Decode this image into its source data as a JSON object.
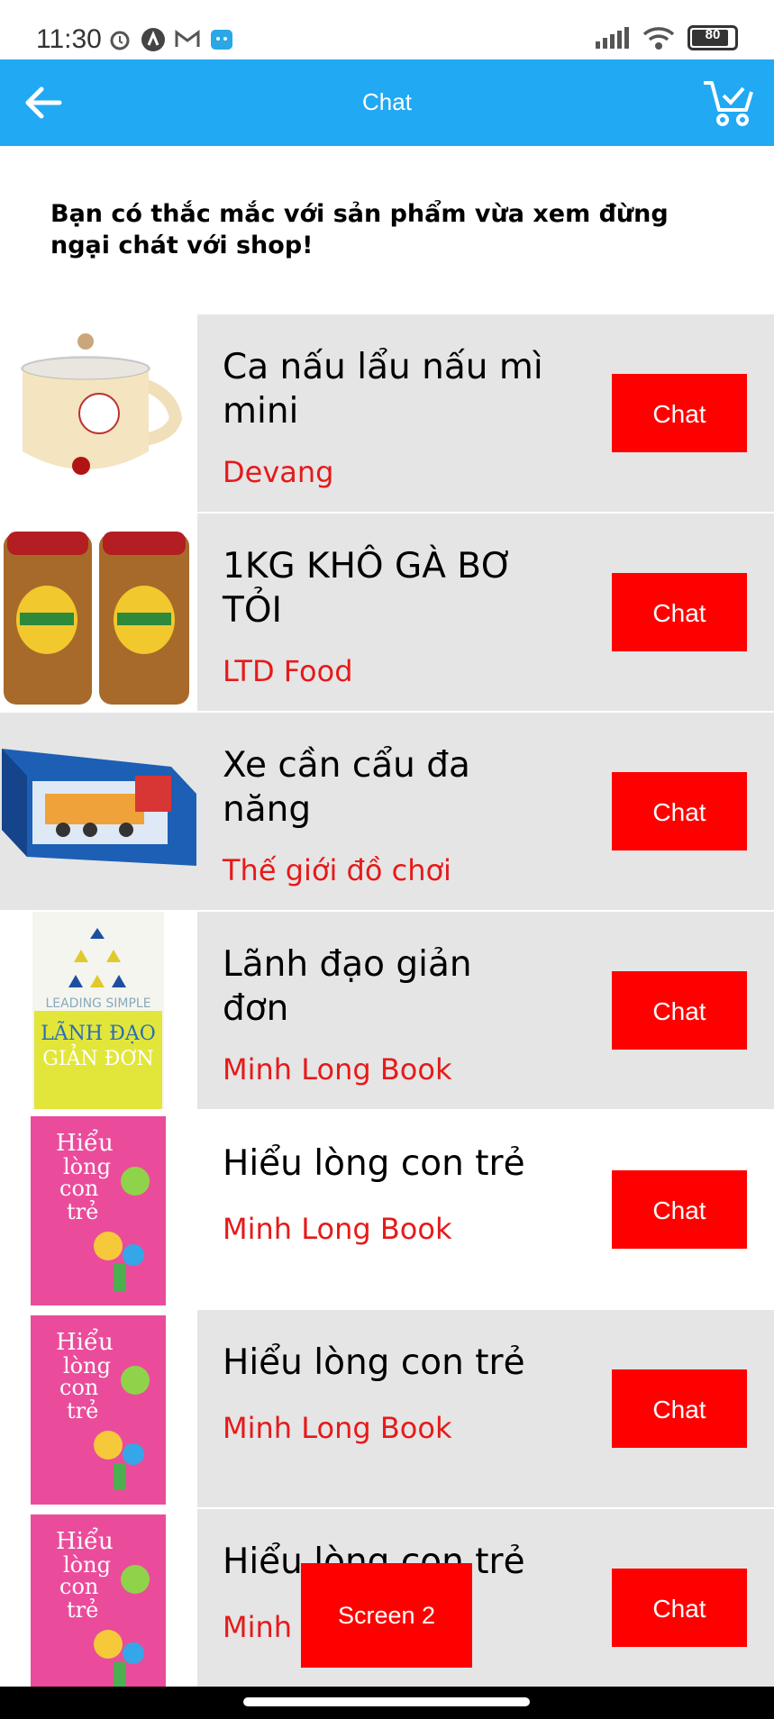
{
  "status": {
    "time": "11:30",
    "battery": "80"
  },
  "appbar": {
    "title": "Chat"
  },
  "intro": "Bạn có thắc mắc với sản phẩm vừa xem đừng ngại chát với shop!",
  "items": [
    {
      "name": "Ca nấu lẩu nấu mì mini",
      "shop": "Devang",
      "chat": "Chat"
    },
    {
      "name": "1KG KHÔ GÀ BƠ TỎI",
      "shop": "LTD Food",
      "chat": "Chat"
    },
    {
      "name": "Xe cần cẩu đa năng",
      "shop": "Thế giới đồ chơi",
      "chat": "Chat"
    },
    {
      "name": "Lãnh đạo giản đơn",
      "shop": "Minh Long Book",
      "chat": "Chat"
    },
    {
      "name": "Hiểu lòng con trẻ",
      "shop": "Minh Long Book",
      "chat": "Chat"
    },
    {
      "name": "Hiểu lòng con trẻ",
      "shop": "Minh Long Book",
      "chat": "Chat"
    },
    {
      "name": "Hiểu lòng con trẻ",
      "shop": "Minh Long Book",
      "chat": "Chat"
    }
  ],
  "book_cover": {
    "title_1": "LEADING SIMPLE",
    "title_2": "LÃNH ĐẠO",
    "title_3": "GIẢN ĐƠN"
  },
  "kids_cover": {
    "line1": "Hiểu",
    "line2": "lòng",
    "line3": "con",
    "line4": "trẻ"
  },
  "floating_button": "Screen 2",
  "colors": {
    "accent": "#21a9f3",
    "chat_button": "#ff0000",
    "shop_text": "#e61a1a"
  }
}
